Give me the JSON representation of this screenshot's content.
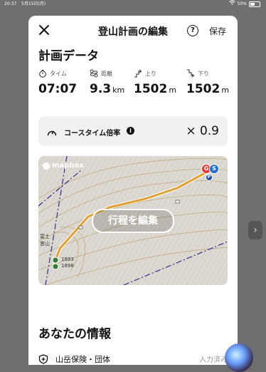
{
  "status_bar": {
    "time": "20:37",
    "date": "5月15日(月)",
    "battery": "50%"
  },
  "header": {
    "title": "登山計画の編集",
    "help_label": "?",
    "save_label": "保存"
  },
  "plan_data": {
    "title": "計画データ",
    "stats": [
      {
        "label": "タイム",
        "value": "07:07",
        "unit": "",
        "icon": "stopwatch-icon"
      },
      {
        "label": "距離",
        "value": "9.3",
        "unit": "km",
        "icon": "distance-icon"
      },
      {
        "label": "上り",
        "value": "1502",
        "unit": "m",
        "icon": "ascent-icon"
      },
      {
        "label": "下り",
        "value": "1502",
        "unit": "m",
        "icon": "descent-icon"
      }
    ]
  },
  "course_time": {
    "label": "コースタイム倍率",
    "value": "× 0.9"
  },
  "map": {
    "logo": "mapbox",
    "edit_label": "行程を編集",
    "place_labels": [
      "富士",
      "宮山"
    ],
    "elevation_labels": [
      "1893",
      "1898"
    ],
    "markers": [
      "G",
      "S",
      "P"
    ]
  },
  "your_info": {
    "title": "あなたの情報",
    "insurance_label": "山岳保険・団体",
    "insurance_status": "入力済み"
  },
  "colors": {
    "route": "#e0a030",
    "goal": "#e53935",
    "start": "#1e6fd9",
    "parking": "#1e4fa0"
  }
}
